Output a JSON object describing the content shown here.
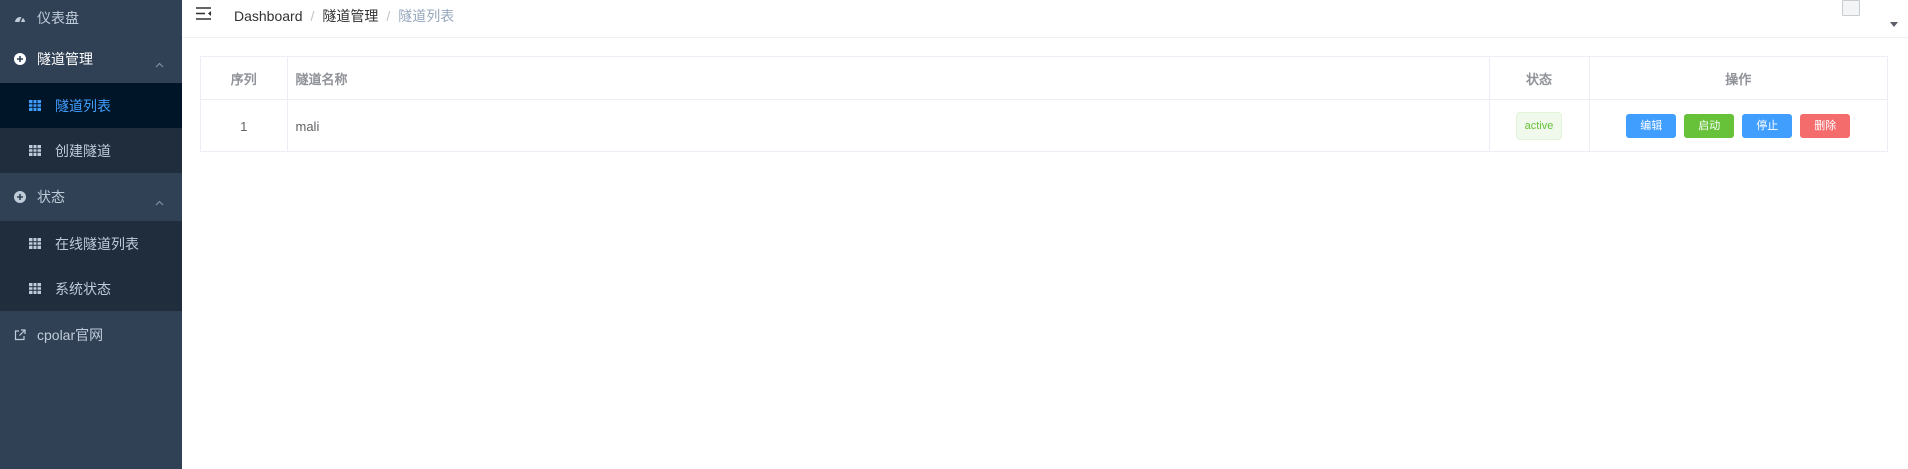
{
  "sidebar": {
    "dashboard": "仪表盘",
    "tunnel_mgmt": "隧道管理",
    "tunnel_list": "隧道列表",
    "create_tunnel": "创建隧道",
    "status": "状态",
    "online_tunnels": "在线隧道列表",
    "system_status": "系统状态",
    "cpolar_site": "cpolar官网"
  },
  "breadcrumb": {
    "home": "Dashboard",
    "section": "隧道管理",
    "current": "隧道列表",
    "separator": "/"
  },
  "table": {
    "headers": {
      "index": "序列",
      "name": "隧道名称",
      "status": "状态",
      "actions": "操作"
    },
    "rows": [
      {
        "index": "1",
        "name": "mali",
        "status": "active"
      }
    ],
    "actions": {
      "edit": "编辑",
      "start": "启动",
      "stop": "停止",
      "delete": "删除"
    }
  },
  "colors": {
    "sidebar_bg": "#304156",
    "submenu_bg": "#1f2d3d",
    "active_submenu_bg": "#001528",
    "accent": "#409eff",
    "success": "#67c23a",
    "danger": "#f56c6c"
  },
  "icons": {
    "dashboard": "dashboard-icon",
    "group": "plus-circle-icon",
    "submenu": "table-grid-icon",
    "external": "external-link-icon",
    "hamburger": "hamburger-icon"
  }
}
